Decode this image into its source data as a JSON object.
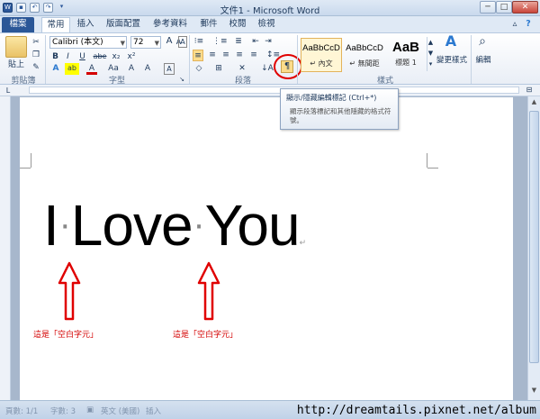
{
  "window": {
    "title": "文件1 - Microsoft Word",
    "app_icon": "W",
    "controls": [
      "─",
      "□",
      "✕"
    ]
  },
  "quick_access": [
    "save-icon",
    "undo-icon",
    "redo-icon",
    "customize-icon"
  ],
  "tabs": [
    {
      "label": "檔案",
      "type": "file"
    },
    {
      "label": "常用",
      "active": true
    },
    {
      "label": "插入"
    },
    {
      "label": "版面配置"
    },
    {
      "label": "參考資料"
    },
    {
      "label": "郵件"
    },
    {
      "label": "校閱"
    },
    {
      "label": "檢視"
    }
  ],
  "ribbon": {
    "clipboard": {
      "paste_label": "貼上",
      "group_label": "剪貼簿"
    },
    "font": {
      "font_name": "Calibri (本文)",
      "font_size": "72",
      "grow_label": "A",
      "shrink_label": "A",
      "clear_label": "Aa",
      "bold": "B",
      "italic": "I",
      "underline": "U",
      "strike": "abe",
      "subscript": "x₂",
      "superscript": "x²",
      "effects": "A",
      "highlight": "ab",
      "color": "A",
      "case": "Aa",
      "phonetic": "A",
      "border": "A",
      "group_label": "字型"
    },
    "paragraph": {
      "group_label": "段落",
      "show_marks_icon": "¶"
    },
    "styles": {
      "items": [
        {
          "sample": "AaBbCcD",
          "name": "↵ 內文",
          "selected": true
        },
        {
          "sample": "AaBbCcD",
          "name": "↵ 無間距"
        },
        {
          "sample": "AaB",
          "name": "標題 1"
        }
      ],
      "change_label": "變更樣式",
      "group_label": "樣式"
    },
    "editing": {
      "label": "編輯"
    }
  },
  "tooltip": {
    "title": "顯示/隱藏編輯標記 (Ctrl+*)",
    "description": "顯示段落標記和其他隱藏的格式符號。"
  },
  "document": {
    "words": [
      "I",
      "Love",
      "You"
    ],
    "space_mark": "·",
    "paragraph_mark": "↵"
  },
  "annotations": [
    {
      "text": "這是「空白字元」"
    },
    {
      "text": "這是「空白字元」"
    }
  ],
  "status_bar": {
    "page": "頁數: 1/1",
    "words": "字數: 3",
    "language": "英文 (美國)",
    "mode": "插入"
  },
  "watermark": "http://dreamtails.pixnet.net/album",
  "colors": {
    "annotation": "#d40000",
    "file_tab": "#2b5797",
    "highlight_circle": "#e00000"
  }
}
